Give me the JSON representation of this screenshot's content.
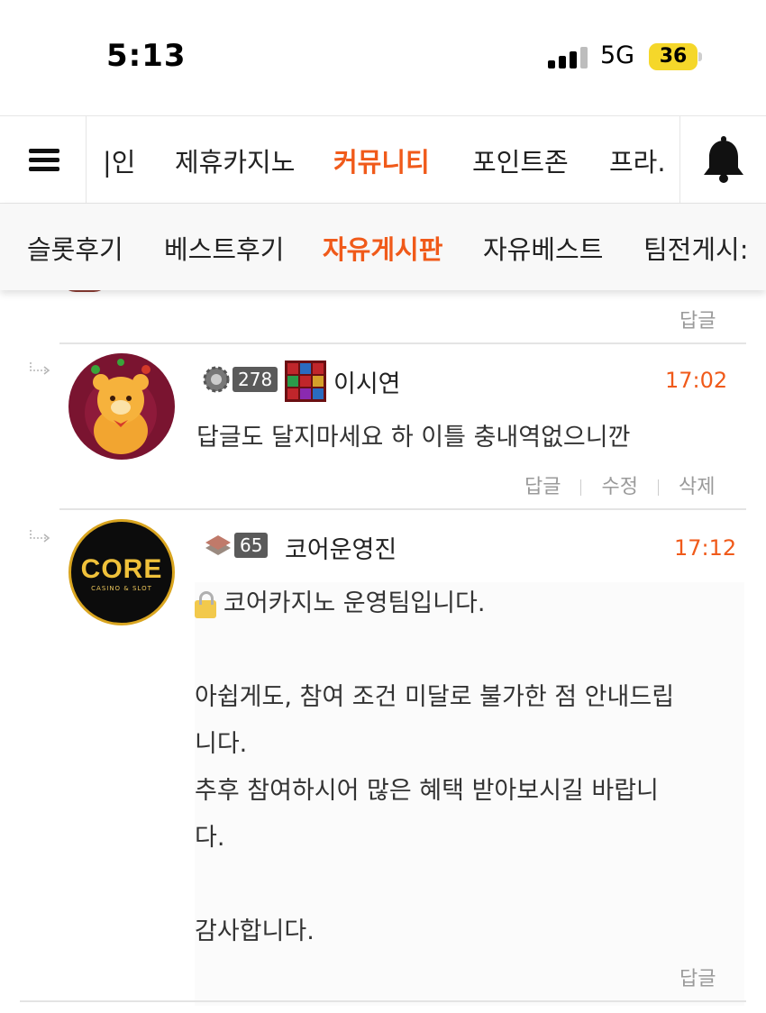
{
  "status_bar": {
    "time": "5:13",
    "network": "5G",
    "battery": "36"
  },
  "main_nav": {
    "items": [
      {
        "label": "|인",
        "active": false
      },
      {
        "label": "제휴카지노",
        "active": false
      },
      {
        "label": "커뮤니티",
        "active": true
      },
      {
        "label": "포인트존",
        "active": false
      },
      {
        "label": "프라.",
        "active": false
      }
    ]
  },
  "sub_nav": {
    "items": [
      {
        "label": "슬롯후기",
        "active": false
      },
      {
        "label": "베스트후기",
        "active": false
      },
      {
        "label": "자유게시판",
        "active": true
      },
      {
        "label": "자유베스트",
        "active": false
      },
      {
        "label": "팀전게시:",
        "active": false
      }
    ]
  },
  "comments": {
    "previous_reply_label": "답글",
    "items": [
      {
        "level": "278",
        "author": "이시연",
        "time": "17:02",
        "text": "답글도 달지마세요 하 이틀 충내역없으니깐",
        "actions": [
          "답글",
          "수정",
          "삭제"
        ]
      },
      {
        "level": "65",
        "avatar_text": "CORE",
        "avatar_subtext": "CASINO & SLOT",
        "author": "코어운영진",
        "time": "17:12",
        "text": "코어카지노 운영팀입니다.\n\n아쉽게도, 참여 조건 미달로 불가한 점 안내드립\n니다.\n추후 참여하시어 많은 혜택 받아보시길 바랍니\n다.\n\n감사합니다.",
        "actions": [
          "답글"
        ]
      }
    ]
  },
  "colors": {
    "accent": "#f05a1a",
    "muted": "#9a9a9a"
  }
}
